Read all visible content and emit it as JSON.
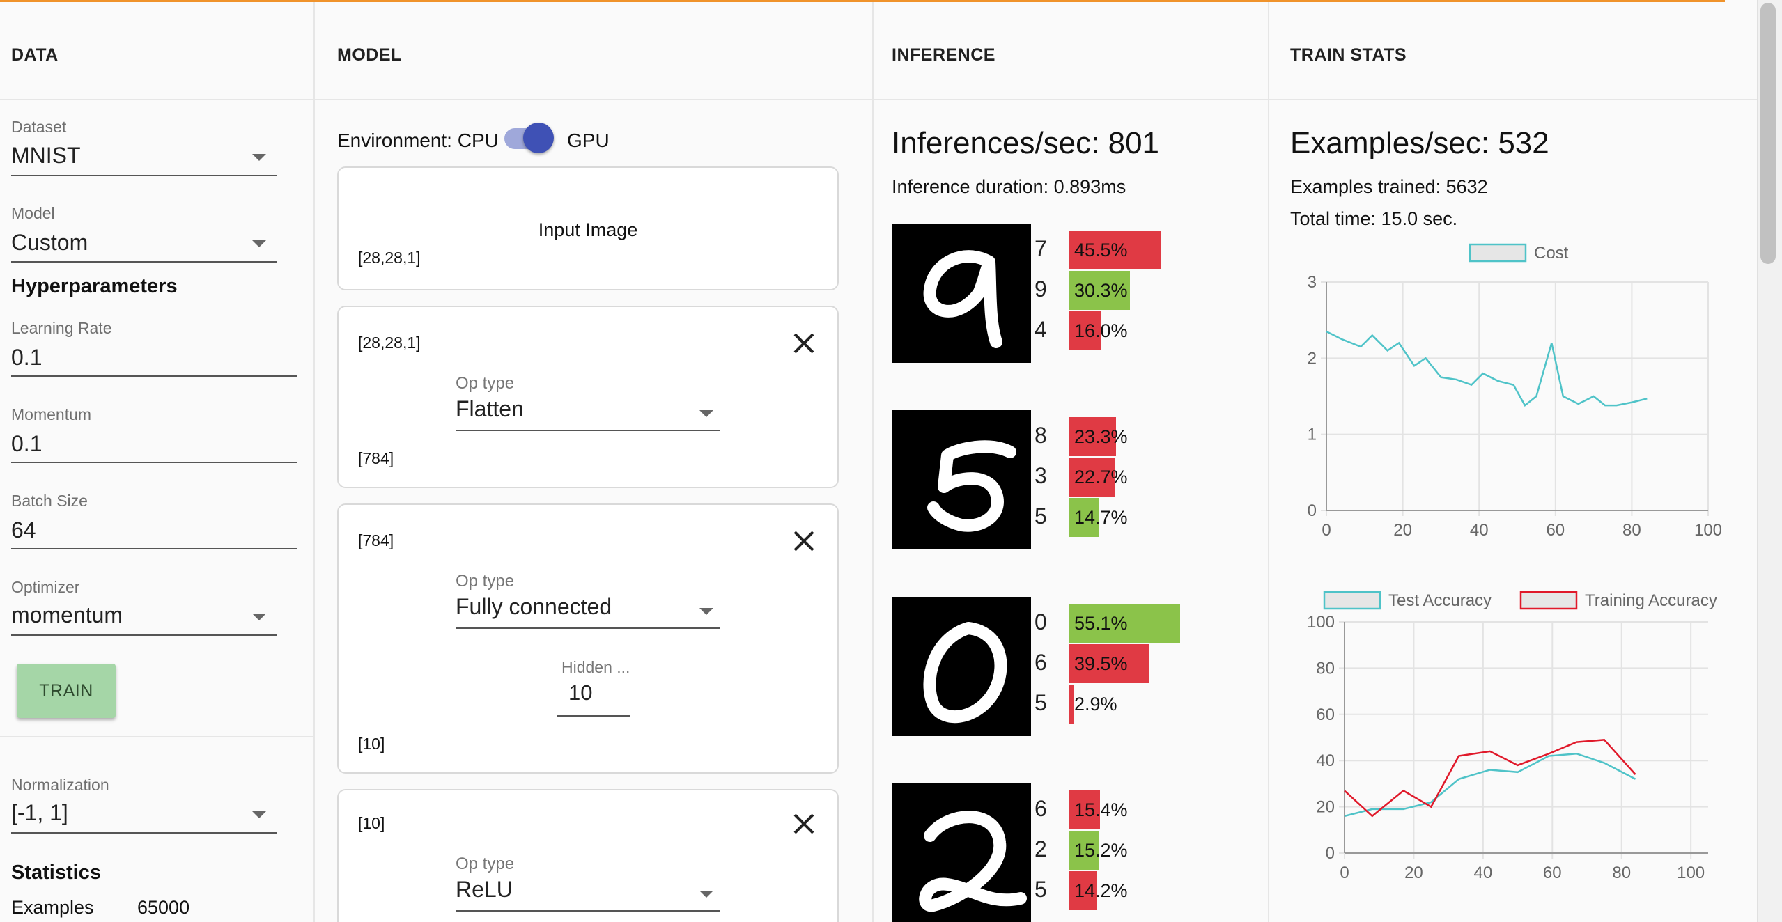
{
  "columns": {
    "data": "DATA",
    "model": "MODEL",
    "inference": "INFERENCE",
    "train_stats": "TRAIN STATS"
  },
  "data_panel": {
    "dataset": {
      "label": "Dataset",
      "value": "MNIST"
    },
    "model": {
      "label": "Model",
      "value": "Custom"
    },
    "hyperparameters_heading": "Hyperparameters",
    "learning_rate": {
      "label": "Learning Rate",
      "value": "0.1"
    },
    "momentum": {
      "label": "Momentum",
      "value": "0.1"
    },
    "batch_size": {
      "label": "Batch Size",
      "value": "64"
    },
    "optimizer": {
      "label": "Optimizer",
      "value": "momentum"
    },
    "train_button": "TRAIN",
    "normalization": {
      "label": "Normalization",
      "value": "[-1, 1]"
    },
    "statistics_heading": "Statistics",
    "examples": {
      "label": "Examples",
      "value": "65000"
    }
  },
  "model_panel": {
    "environment_label": "Environment: CPU",
    "gpu_label": "GPU",
    "input_card": {
      "title": "Input Image",
      "shape": "[28,28,1]"
    },
    "layers": [
      {
        "in_shape": "[28,28,1]",
        "optype_label": "Op type",
        "optype": "Flatten",
        "out_shape": "[784]"
      },
      {
        "in_shape": "[784]",
        "optype_label": "Op type",
        "optype": "Fully connected",
        "hidden_label": "Hidden ...",
        "hidden_value": "10",
        "out_shape": "[10]"
      },
      {
        "in_shape": "[10]",
        "optype_label": "Op type",
        "optype": "ReLU"
      }
    ]
  },
  "inference_panel": {
    "rate": "Inferences/sec: 801",
    "duration": "Inference duration: 0.893ms",
    "samples": [
      {
        "image_digit": "9",
        "preds": [
          {
            "label": "7",
            "pct": "45.5%",
            "value": 45.5,
            "correct": false
          },
          {
            "label": "9",
            "pct": "30.3%",
            "value": 30.3,
            "correct": true
          },
          {
            "label": "4",
            "pct": "16.0%",
            "value": 16.0,
            "correct": false
          }
        ]
      },
      {
        "image_digit": "5",
        "preds": [
          {
            "label": "8",
            "pct": "23.3%",
            "value": 23.3,
            "correct": false
          },
          {
            "label": "3",
            "pct": "22.7%",
            "value": 22.7,
            "correct": false
          },
          {
            "label": "5",
            "pct": "14.7%",
            "value": 14.7,
            "correct": true
          }
        ]
      },
      {
        "image_digit": "0",
        "preds": [
          {
            "label": "0",
            "pct": "55.1%",
            "value": 55.1,
            "correct": true
          },
          {
            "label": "6",
            "pct": "39.5%",
            "value": 39.5,
            "correct": false
          },
          {
            "label": "5",
            "pct": "2.9%",
            "value": 2.9,
            "correct": false
          }
        ]
      },
      {
        "image_digit": "2",
        "preds": [
          {
            "label": "6",
            "pct": "15.4%",
            "value": 15.4,
            "correct": false
          },
          {
            "label": "2",
            "pct": "15.2%",
            "value": 15.2,
            "correct": true
          },
          {
            "label": "5",
            "pct": "14.2%",
            "value": 14.2,
            "correct": false
          }
        ]
      }
    ],
    "colors": {
      "correct": "#8bc34a",
      "incorrect": "#e03a44"
    }
  },
  "stats_panel": {
    "rate": "Examples/sec: 532",
    "examples_trained": "Examples trained: 5632",
    "total_time": "Total time: 15.0 sec."
  },
  "chart_data": [
    {
      "type": "line",
      "title": "",
      "xlabel": "",
      "ylabel": "",
      "xlim": [
        0,
        100
      ],
      "ylim": [
        0,
        3
      ],
      "xticks": [
        "0",
        "20",
        "40",
        "60",
        "80",
        "100"
      ],
      "yticks": [
        "0",
        "1",
        "2",
        "3"
      ],
      "grid": true,
      "legend": "top-center",
      "series": [
        {
          "name": "Cost",
          "color": "#4fc3c8",
          "x": [
            0,
            4,
            9,
            12,
            16,
            19,
            23,
            26,
            30,
            34,
            38,
            41,
            45,
            49,
            52,
            55,
            59,
            62,
            66,
            70,
            73,
            76,
            80,
            84
          ],
          "y": [
            2.35,
            2.25,
            2.15,
            2.3,
            2.1,
            2.2,
            1.9,
            2.0,
            1.75,
            1.72,
            1.65,
            1.8,
            1.7,
            1.65,
            1.38,
            1.5,
            2.2,
            1.5,
            1.4,
            1.5,
            1.38,
            1.38,
            1.42,
            1.47
          ]
        }
      ]
    },
    {
      "type": "line",
      "title": "",
      "xlabel": "",
      "ylabel": "",
      "xlim": [
        0,
        105
      ],
      "ylim": [
        0,
        100
      ],
      "xticks": [
        "0",
        "20",
        "40",
        "60",
        "80",
        "100"
      ],
      "yticks": [
        "0",
        "20",
        "40",
        "60",
        "80",
        "100"
      ],
      "grid": true,
      "legend": "top-center",
      "series": [
        {
          "name": "Test Accuracy",
          "color": "#4fc3c8",
          "x": [
            0,
            8,
            17,
            25,
            33,
            42,
            50,
            59,
            67,
            75,
            84
          ],
          "y": [
            16,
            19,
            19,
            22,
            32,
            36,
            35,
            42,
            43,
            39,
            32
          ]
        },
        {
          "name": "Training Accuracy",
          "color": "#e0192a",
          "x": [
            0,
            8,
            17,
            25,
            33,
            42,
            50,
            59,
            67,
            75,
            84
          ],
          "y": [
            27,
            16,
            27,
            20,
            42,
            44,
            38,
            43,
            48,
            49,
            34
          ]
        }
      ]
    }
  ]
}
